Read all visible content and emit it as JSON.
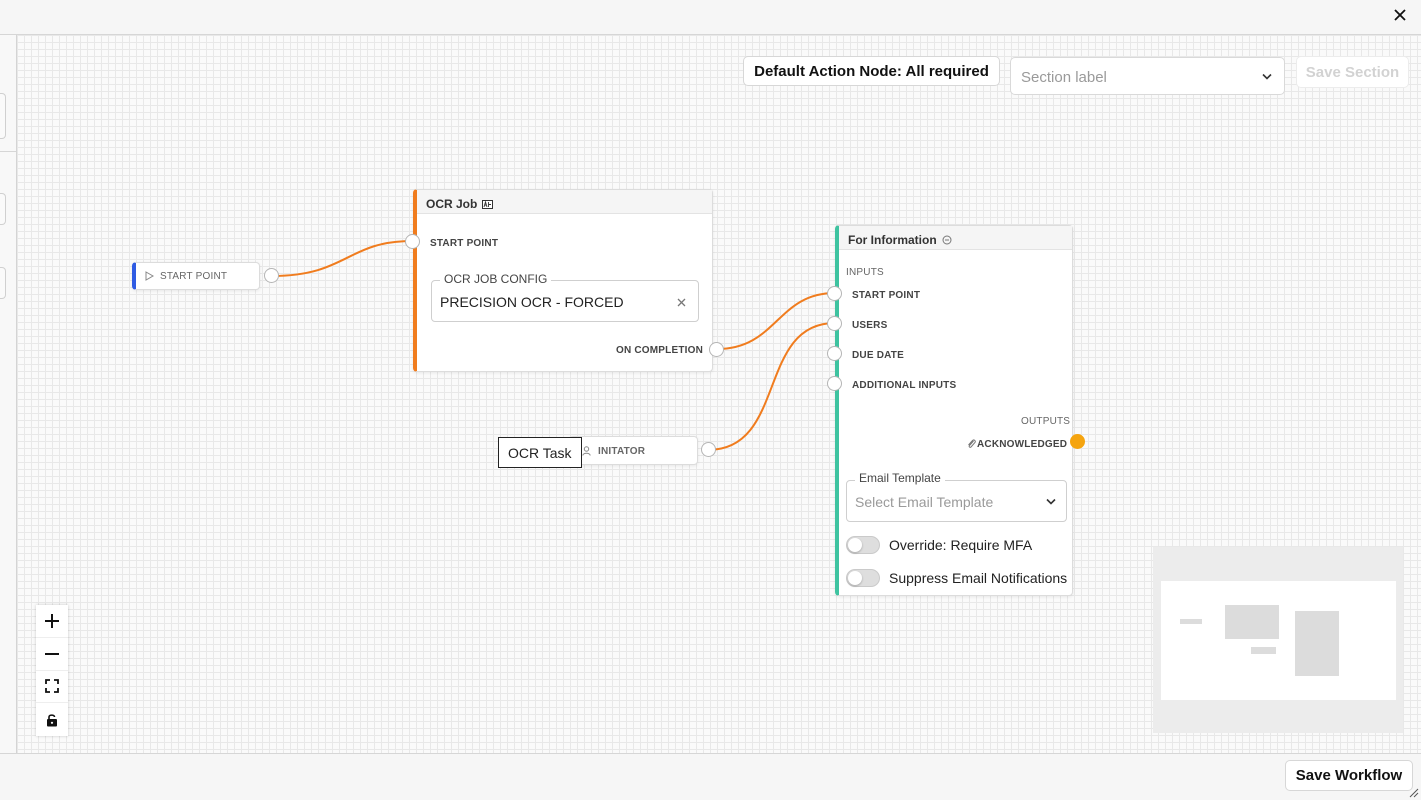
{
  "dialog": {
    "close_icon": "close-icon"
  },
  "toolbar": {
    "default_node_label": "Default Action Node: All required",
    "section_label_placeholder": "Section label",
    "save_section_label": "Save Section"
  },
  "nodes": {
    "start": {
      "label": "START POINT",
      "accent": "#2f5be3"
    },
    "ocr_job": {
      "title": "OCR Job",
      "accent": "#f07c1e",
      "input_start": "START POINT",
      "config_legend": "OCR JOB CONFIG",
      "config_value": "PRECISION OCR - FORCED",
      "output_completion": "ON COMPLETION"
    },
    "ocr_task": {
      "tooltip": "OCR Task",
      "initiator_label": "INITATOR"
    },
    "for_information": {
      "title": "For Information",
      "accent": "#3ec3a0",
      "inputs_heading": "INPUTS",
      "inputs": [
        "START POINT",
        "USERS",
        "DUE DATE",
        "ADDITIONAL INPUTS"
      ],
      "outputs_heading": "OUTPUTS",
      "output_acknowledged": "ACKNOWLEDGED",
      "output_color": "#f5a40f",
      "email_legend": "Email Template",
      "email_placeholder": "Select Email Template",
      "toggle_mfa": "Override: Require MFA",
      "toggle_suppress": "Suppress Email Notifications"
    }
  },
  "edge_color": "#f07c1e",
  "footer": {
    "save_workflow_label": "Save Workflow"
  }
}
